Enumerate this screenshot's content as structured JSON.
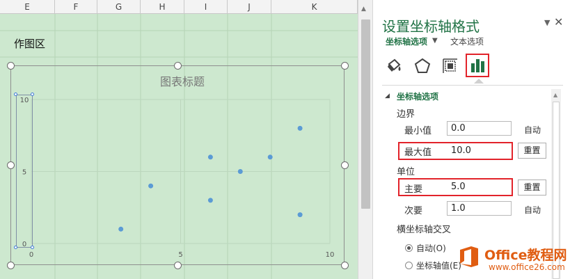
{
  "sheet": {
    "columns": [
      "E",
      "F",
      "G",
      "H",
      "I",
      "J",
      "K"
    ],
    "plot_area_label": "作图区"
  },
  "chart": {
    "title": "图表标题"
  },
  "chart_data": {
    "type": "scatter",
    "title": "图表标题",
    "xlabel": "",
    "ylabel": "",
    "xlim": [
      0,
      10
    ],
    "ylim": [
      0,
      10
    ],
    "x_ticks": [
      "0",
      "5",
      "10"
    ],
    "y_ticks": [
      "0",
      "5",
      "10"
    ],
    "grid": true,
    "points": [
      {
        "x": 3.0,
        "y": 1.0
      },
      {
        "x": 4.0,
        "y": 4.0
      },
      {
        "x": 6.0,
        "y": 6.0
      },
      {
        "x": 6.0,
        "y": 3.0
      },
      {
        "x": 7.0,
        "y": 5.0
      },
      {
        "x": 8.0,
        "y": 6.0
      },
      {
        "x": 9.0,
        "y": 8.0
      },
      {
        "x": 9.0,
        "y": 2.0
      }
    ],
    "marker_color": "#5b9bd5"
  },
  "pane": {
    "title": "设置坐标轴格式",
    "tab_axis_options": "坐标轴选项",
    "tab_text_options": "文本选项",
    "icons": [
      "fill-line-icon",
      "effects-icon",
      "size-properties-icon",
      "axis-options-icon"
    ],
    "section_title": "坐标轴选项",
    "bounds_label": "边界",
    "min_label": "最小值",
    "min_value": "0.0",
    "min_state": "自动",
    "max_label": "最大值",
    "max_value": "10.0",
    "max_button": "重置",
    "units_label": "单位",
    "major_label": "主要",
    "major_value": "5.0",
    "major_button": "重置",
    "minor_label": "次要",
    "minor_value": "1.0",
    "minor_state": "自动",
    "cross_label": "横坐标轴交叉",
    "radio_auto": "自动(O)",
    "radio_axis_value": "坐标轴值(E)"
  },
  "watermark": {
    "title": "Office教程网",
    "url": "www.office26.com"
  },
  "colors": {
    "accent": "#217346",
    "highlight": "#e2232a",
    "marker": "#5b9bd5",
    "sheet_bg": "#cde8cf"
  }
}
